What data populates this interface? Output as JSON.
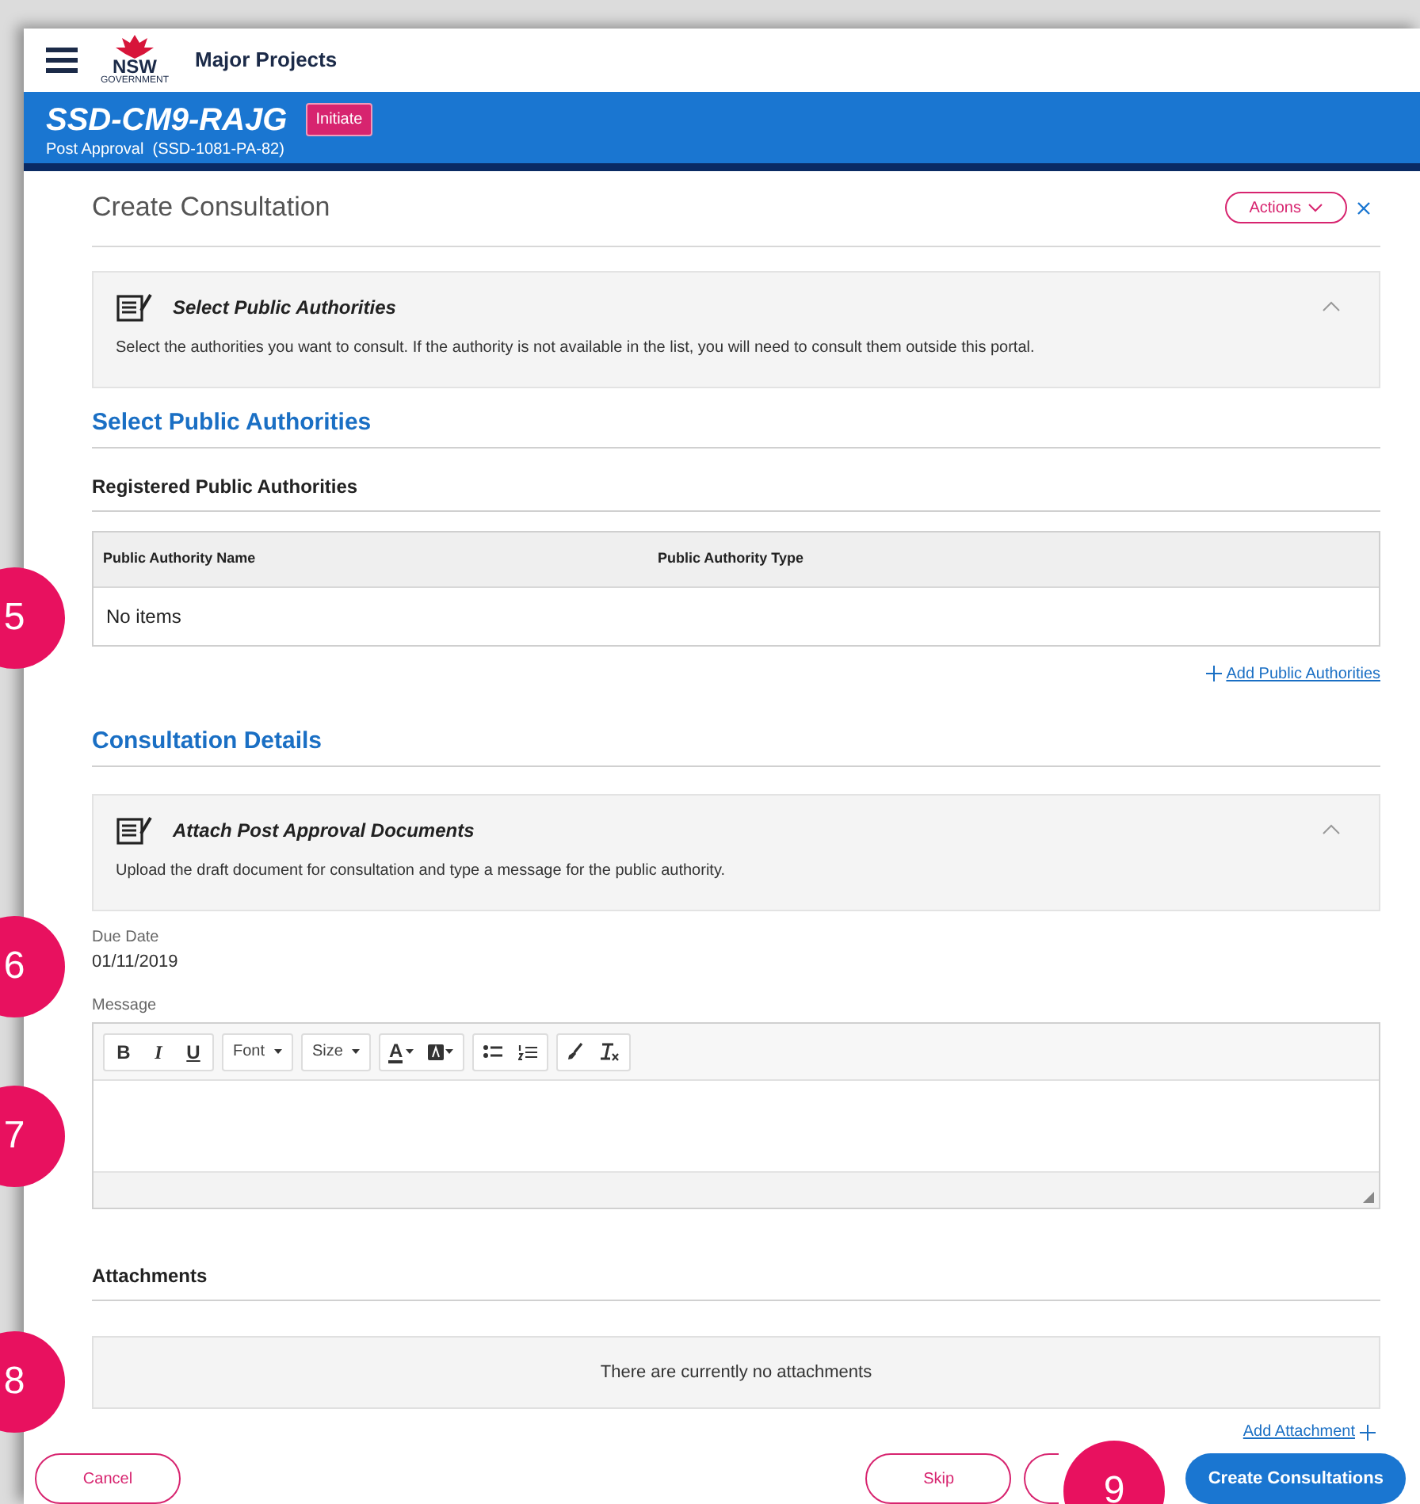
{
  "header": {
    "logo_text": "NSW",
    "logo_subtext": "GOVERNMENT",
    "app_title": "Major Projects"
  },
  "project": {
    "id": "SSD-CM9-RAJG",
    "status": "Initiate",
    "subtitle": "Post Approval  (SSD-1081-PA-82)"
  },
  "panel": {
    "title": "Create Consultation",
    "actions": "Actions"
  },
  "public_authorities": {
    "info": {
      "title": "Select Public Authorities",
      "text": "Select the authorities you want to consult. If the authority is not available in the list, you will need to consult them outside this portal.",
      "expanded": true
    },
    "heading": "Select Public Authorities",
    "subheading": "Registered Public Authorities",
    "table": {
      "columns": [
        "Public Authority Name",
        "Public Authority Type"
      ],
      "empty_text": "No items"
    },
    "add_link": "Add Public Authorities"
  },
  "consultation_details": {
    "heading": "Consultation Details",
    "info": {
      "title": "Attach Post Approval Documents",
      "text": "Upload the draft document for consultation and type a message for the public authority.",
      "expanded": true
    },
    "due_date": {
      "label": "Due Date",
      "value": "01/11/2019"
    },
    "message": {
      "label": "Message",
      "toolbar": [
        [
          {
            "kind": "bold",
            "label": "B"
          },
          {
            "kind": "italic",
            "label": "I"
          },
          {
            "kind": "underline",
            "label": "U"
          }
        ],
        [
          {
            "kind": "dropdown",
            "label": "Font"
          }
        ],
        [
          {
            "kind": "dropdown",
            "label": "Size"
          }
        ],
        [
          {
            "kind": "text_color",
            "label": "A"
          },
          {
            "kind": "bg_color"
          }
        ],
        [
          {
            "kind": "bullets"
          },
          {
            "kind": "numbers"
          }
        ],
        [
          {
            "kind": "brush"
          },
          {
            "kind": "clear"
          }
        ]
      ]
    }
  },
  "attachments": {
    "heading": "Attachments",
    "empty_text": "There are currently no attachments",
    "add_link": "Add Attachment"
  },
  "footer": {
    "buttons": [
      {
        "kind": "outline",
        "label": "Cancel"
      },
      {
        "kind": "spacer"
      },
      {
        "kind": "outline",
        "label": "Skip"
      },
      {
        "kind": "outline_hidden"
      },
      {
        "kind": "primary",
        "label": "Create Consultations"
      }
    ]
  },
  "callouts": [
    {
      "label": "5"
    },
    {
      "label": "6"
    },
    {
      "label": "7"
    },
    {
      "label": "8"
    },
    {
      "label": "9"
    }
  ]
}
